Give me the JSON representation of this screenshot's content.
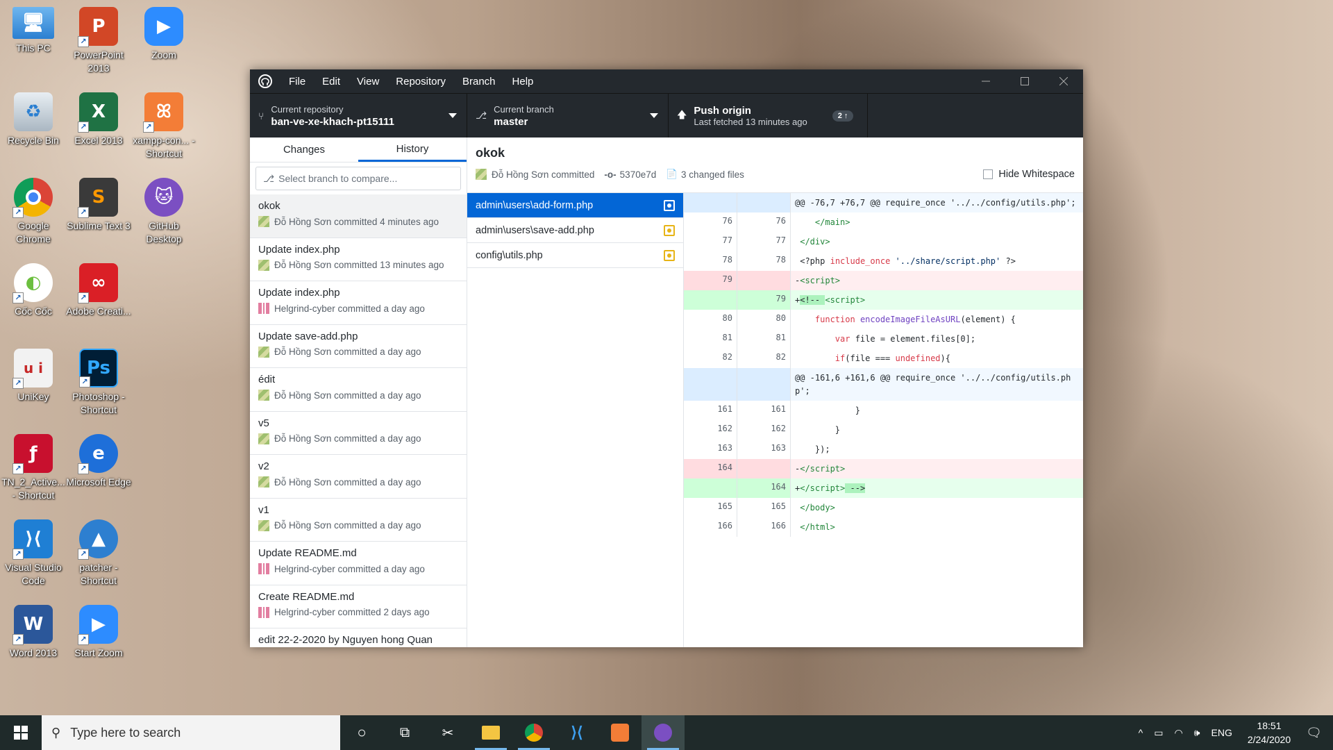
{
  "desktop_icons": [
    {
      "label": "This PC"
    },
    {
      "label": "PowerPoint 2013"
    },
    {
      "label": "Zoom"
    },
    {
      "label": "Recycle Bin"
    },
    {
      "label": "Excel 2013"
    },
    {
      "label": "xampp-con... - Shortcut"
    },
    {
      "label": "Google Chrome"
    },
    {
      "label": "Sublime Text 3"
    },
    {
      "label": "GitHub Desktop"
    },
    {
      "label": "Cốc Cốc"
    },
    {
      "label": "Adobe Creati..."
    },
    {
      "label": "UniKey"
    },
    {
      "label": "Photoshop - Shortcut"
    },
    {
      "label": "TN_2_Active... - Shortcut"
    },
    {
      "label": "Microsoft Edge"
    },
    {
      "label": "Visual Studio Code"
    },
    {
      "label": "patcher - Shortcut"
    },
    {
      "label": "Word 2013"
    },
    {
      "label": "Start Zoom"
    }
  ],
  "menu": [
    "File",
    "Edit",
    "View",
    "Repository",
    "Branch",
    "Help"
  ],
  "toolbar": {
    "repo_caption": "Current repository",
    "repo_name": "ban-ve-xe-khach-pt15111",
    "branch_caption": "Current branch",
    "branch_name": "master",
    "push_title": "Push origin",
    "push_sub": "Last fetched 13 minutes ago",
    "push_badge": "2"
  },
  "tabs": {
    "changes": "Changes",
    "history": "History"
  },
  "compare_placeholder": "Select branch to compare...",
  "commits": [
    {
      "title": "okok",
      "meta": "Đỗ Hồng Sơn committed 4 minutes ago"
    },
    {
      "title": "Update index.php",
      "meta": "Đỗ Hồng Sơn committed 13 minutes ago"
    },
    {
      "title": "Update index.php",
      "meta": "Helgrind-cyber committed a day ago"
    },
    {
      "title": "Update save-add.php",
      "meta": "Đỗ Hồng Sơn committed a day ago"
    },
    {
      "title": "édit",
      "meta": "Đỗ Hồng Sơn committed a day ago"
    },
    {
      "title": "v5",
      "meta": "Đỗ Hồng Sơn committed a day ago"
    },
    {
      "title": "v2",
      "meta": "Đỗ Hồng Sơn committed a day ago"
    },
    {
      "title": "v1",
      "meta": "Đỗ Hồng Sơn committed a day ago"
    },
    {
      "title": "Update README.md",
      "meta": "Helgrind-cyber committed a day ago"
    },
    {
      "title": "Create README.md",
      "meta": "Helgrind-cyber committed 2 days ago"
    },
    {
      "title": "edit 22-2-2020 by Nguyen hong Quan",
      "meta": ""
    }
  ],
  "detail": {
    "title": "okok",
    "author": "Đỗ Hồng Sơn committed",
    "sha": "5370e7d",
    "changed": "3 changed files",
    "hide_ws": "Hide Whitespace"
  },
  "files": [
    {
      "name": "admin\\users\\add-form.php"
    },
    {
      "name": "admin\\users\\save-add.php"
    },
    {
      "name": "config\\utils.php"
    }
  ],
  "diff": {
    "hunk1": "@@ -76,7 +76,7 @@ require_once '../../config/utils.php';",
    "hunk2": "@@ -161,6 +161,6 @@ require_once '../../config/utils.php';",
    "nums": [
      "76",
      "77",
      "78",
      "79",
      "79",
      "80",
      "81",
      "82",
      "161",
      "162",
      "163",
      "164",
      "164",
      "165",
      "166"
    ]
  },
  "taskbar": {
    "search_placeholder": "Type here to search",
    "lang": "ENG",
    "time": "18:51",
    "date": "2/24/2020"
  }
}
